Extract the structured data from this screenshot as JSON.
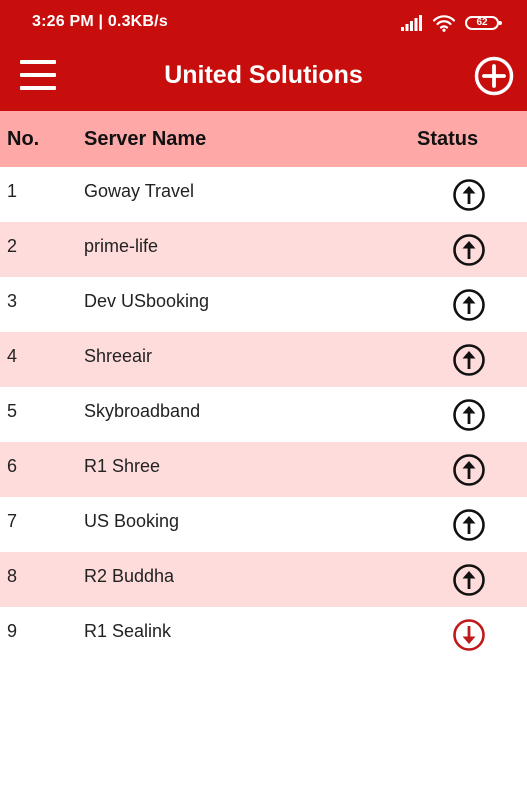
{
  "statusbar": {
    "time": "3:26 PM | 0.3KB/s",
    "battery": "62"
  },
  "appbar": {
    "title": "United Solutions"
  },
  "table": {
    "headers": {
      "no": "No.",
      "name": "Server Name",
      "status": "Status"
    },
    "rows": [
      {
        "no": "1",
        "name": "Goway Travel",
        "status": "up"
      },
      {
        "no": "2",
        "name": "prime-life",
        "status": "up"
      },
      {
        "no": "3",
        "name": "Dev USbooking",
        "status": "up"
      },
      {
        "no": "4",
        "name": "Shreeair",
        "status": "up"
      },
      {
        "no": "5",
        "name": "Skybroadband",
        "status": "up"
      },
      {
        "no": "6",
        "name": "R1 Shree",
        "status": "up"
      },
      {
        "no": "7",
        "name": "US Booking",
        "status": "up"
      },
      {
        "no": "8",
        "name": "R2 Buddha",
        "status": "up"
      },
      {
        "no": "9",
        "name": "R1 Sealink",
        "status": "down"
      }
    ]
  },
  "colors": {
    "primary": "#c80d0d",
    "header_row": "#ffa8a8",
    "alt_row": "#ffdcdc",
    "status_up": "#111111",
    "status_down": "#c0191c"
  },
  "icons": {
    "menu": "menu-icon",
    "add": "add-circle-icon",
    "up": "arrow-up-circle-icon",
    "down": "arrow-down-circle-icon"
  }
}
